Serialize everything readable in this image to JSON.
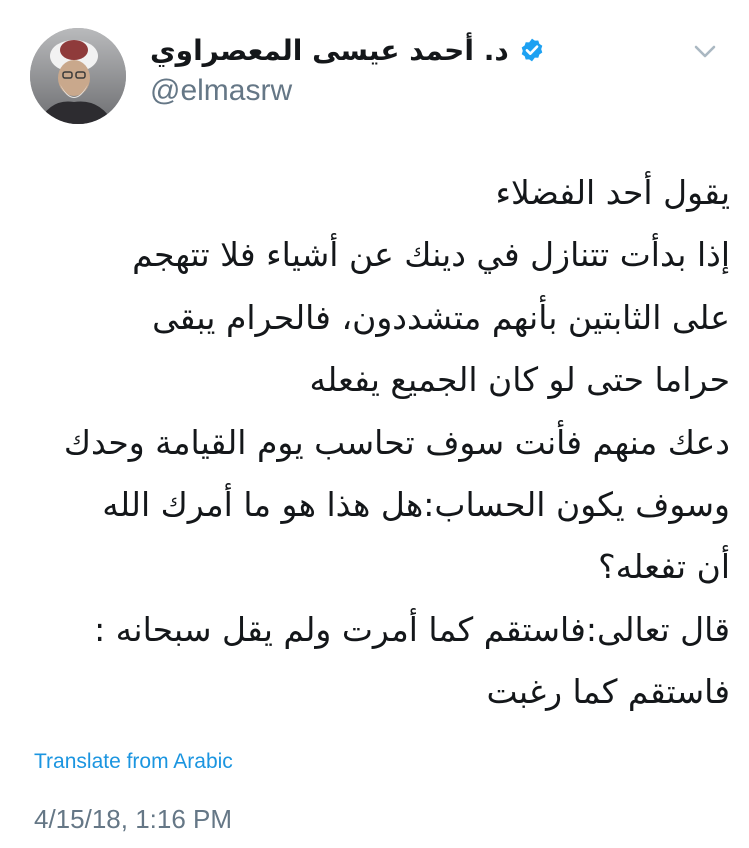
{
  "author": {
    "display_name": "د. أحمد عيسى المعصراوي",
    "handle": "@elmasrw",
    "verified_icon": "verified-badge-icon",
    "avatar": "author-avatar"
  },
  "menu_icon": "chevron-down-icon",
  "tweet": {
    "lines": [
      "يقول أحد الفضلاء",
      "إذا بدأت تتنازل في دينك عن أشياء فلا تتهجم",
      "على الثابتين بأنهم متشددون، فالحرام يبقى",
      "حراما حتى لو كان الجميع يفعله",
      "دعك منهم فأنت سوف تحاسب يوم القيامة وحدك",
      "وسوف يكون الحساب:هل هذا هو ما أمرك الله",
      "أن تفعله؟",
      "قال تعالى:فاستقم كما أمرت ولم يقل سبحانه :",
      "فاستقم كما رغبت"
    ]
  },
  "translate_label": "Translate from Arabic",
  "timestamp": "4/15/18, 1:16 PM",
  "colors": {
    "link": "#1b95e0",
    "verified": "#1da1f2",
    "secondary_text": "#657786",
    "primary_text": "#14171a"
  }
}
